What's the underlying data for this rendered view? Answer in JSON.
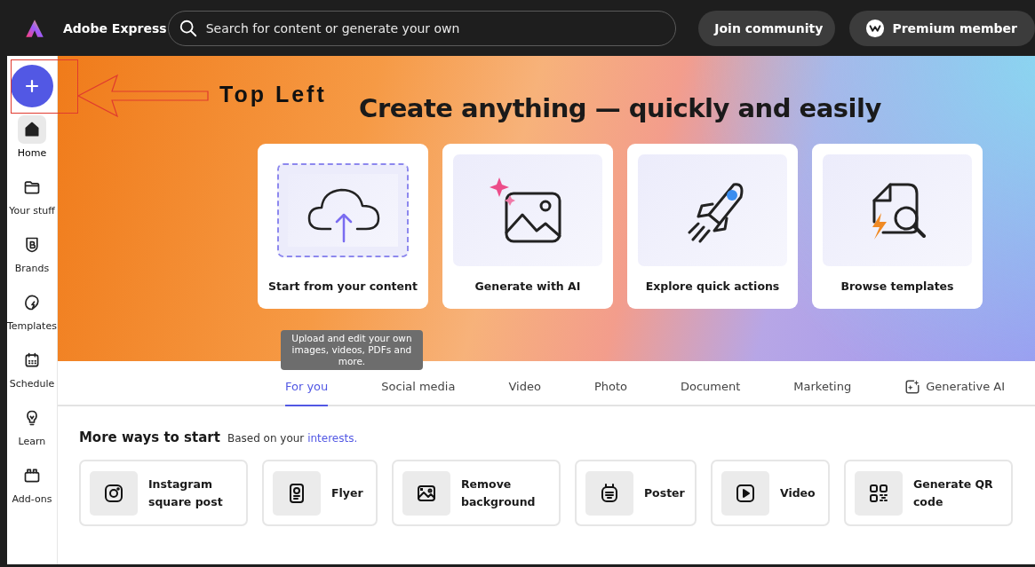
{
  "app": {
    "name": "Adobe Express"
  },
  "search": {
    "placeholder": "Search for content or generate your own"
  },
  "header_buttons": [
    {
      "label": "Join community"
    },
    {
      "label": "Premium member"
    }
  ],
  "sidebar": {
    "items": [
      {
        "label": "Home",
        "selected": true
      },
      {
        "label": "Your stuff",
        "selected": false
      },
      {
        "label": "Brands",
        "selected": false
      },
      {
        "label": "Templates",
        "selected": false
      },
      {
        "label": "Schedule",
        "selected": false
      },
      {
        "label": "Learn",
        "selected": false
      },
      {
        "label": "Add-ons",
        "selected": false
      }
    ]
  },
  "annotation": {
    "label": "Top Left"
  },
  "hero": {
    "title": "Create anything — quickly and easily",
    "cards": [
      {
        "label": "Start from your content"
      },
      {
        "label": "Generate with AI"
      },
      {
        "label": "Explore quick actions"
      },
      {
        "label": "Browse templates"
      }
    ],
    "tooltip": "Upload and edit your own images, videos, PDFs and more."
  },
  "tabs": [
    {
      "label": "For you",
      "selected": true
    },
    {
      "label": "Social media",
      "selected": false
    },
    {
      "label": "Video",
      "selected": false
    },
    {
      "label": "Photo",
      "selected": false
    },
    {
      "label": "Document",
      "selected": false
    },
    {
      "label": "Marketing",
      "selected": false
    },
    {
      "label": "Generative AI",
      "selected": false
    }
  ],
  "more_ways": {
    "title": "More ways to start",
    "subtitle": "Based on your",
    "link": "interests.",
    "items": [
      {
        "label": "Instagram square post"
      },
      {
        "label": "Flyer"
      },
      {
        "label": "Remove background"
      },
      {
        "label": "Poster"
      },
      {
        "label": "Video"
      },
      {
        "label": "Generate QR code"
      }
    ]
  }
}
